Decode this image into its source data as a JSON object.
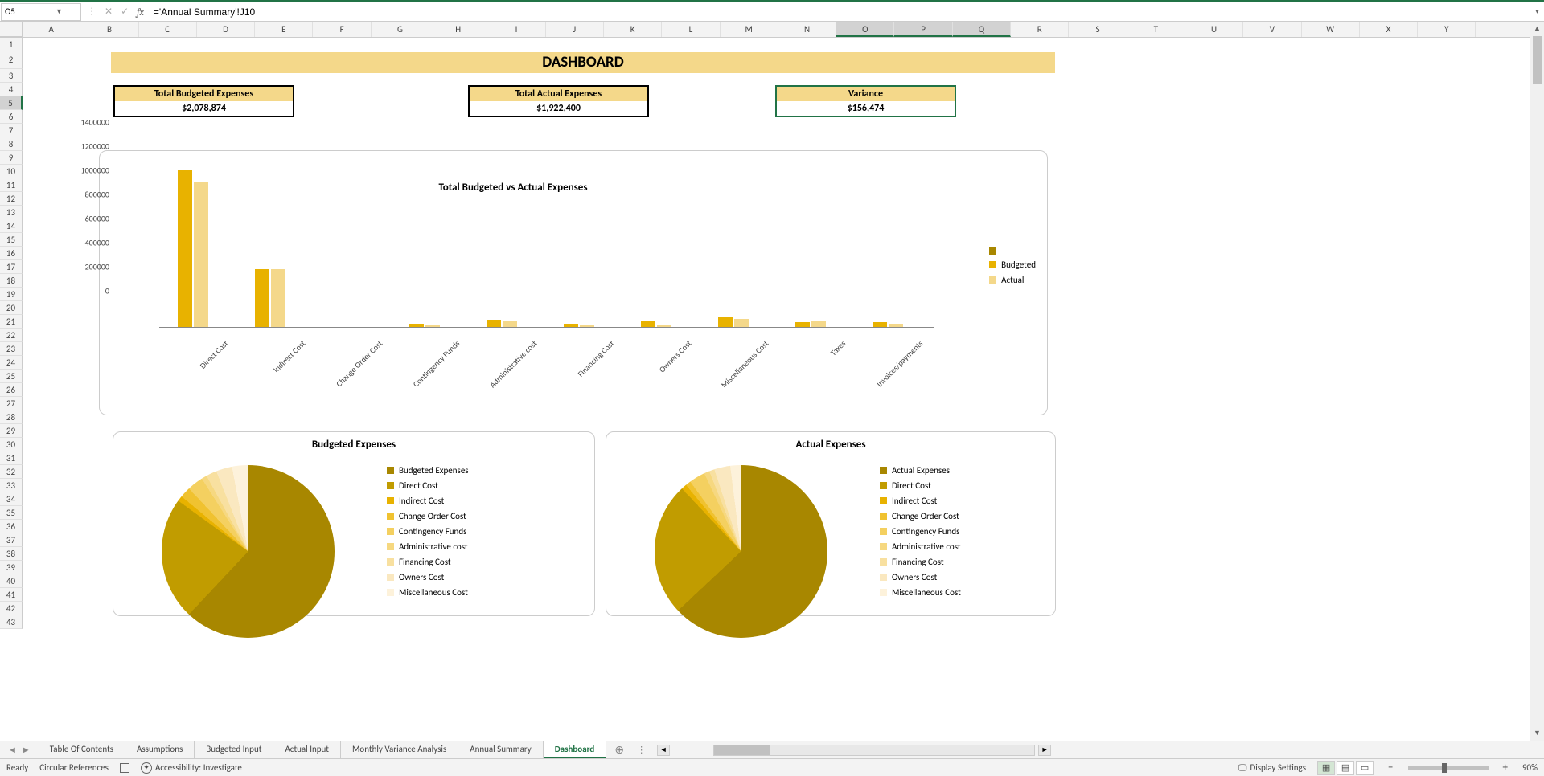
{
  "formula_bar": {
    "cell_ref": "O5",
    "formula": "='Annual Summary'!J10"
  },
  "columns": [
    "A",
    "B",
    "C",
    "D",
    "E",
    "F",
    "G",
    "H",
    "I",
    "J",
    "K",
    "L",
    "M",
    "N",
    "O",
    "P",
    "Q",
    "R",
    "S",
    "T",
    "U",
    "V",
    "W",
    "X",
    "Y"
  ],
  "selected_cols": [
    "O",
    "P",
    "Q"
  ],
  "rows": [
    1,
    2,
    3,
    4,
    5,
    6,
    7,
    8,
    9,
    10,
    11,
    12,
    13,
    14,
    15,
    16,
    17,
    18,
    19,
    20,
    21,
    22,
    23,
    24,
    25,
    26,
    27,
    28,
    29,
    30,
    31,
    32,
    33,
    34,
    35,
    36,
    37,
    38,
    39,
    40,
    41,
    42,
    43
  ],
  "selected_row": 5,
  "dashboard": {
    "title": "DASHBOARD",
    "kpis": [
      {
        "label": "Total Budgeted Expenses",
        "value": "$2,078,874"
      },
      {
        "label": "Total Actual Expenses",
        "value": "$1,922,400"
      },
      {
        "label": "Variance",
        "value": "$156,474",
        "selected": true
      }
    ]
  },
  "chart_data": [
    {
      "type": "bar",
      "title": "Total Budgeted vs Actual Expenses",
      "categories": [
        "Direct Cost",
        "Indirect Cost",
        "Change Order Cost",
        "Contingency Funds",
        "Administrative cost",
        "Financing Cost",
        "Owners Cost",
        "Miscellaneous Cost",
        "Taxes",
        "Invoices/payments"
      ],
      "series": [
        {
          "name": "Budgeted",
          "values": [
            1300000,
            480000,
            0,
            30000,
            60000,
            25000,
            50000,
            80000,
            40000,
            40000
          ]
        },
        {
          "name": "Actual",
          "values": [
            1210000,
            480000,
            0,
            15000,
            55000,
            20000,
            15000,
            70000,
            50000,
            30000
          ]
        }
      ],
      "ylim": [
        0,
        1400000
      ],
      "y_ticks": [
        0,
        200000,
        400000,
        600000,
        800000,
        1000000,
        1200000,
        1400000
      ],
      "xlabel": "",
      "ylabel": "",
      "legend_extra_marker": true
    },
    {
      "type": "pie",
      "title": "Budgeted Expenses",
      "legend": [
        "Budgeted Expenses",
        "Direct Cost",
        "Indirect Cost",
        "Change Order Cost",
        "Contingency Funds",
        "Administrative cost",
        "Financing Cost",
        "Owners Cost",
        "Miscellaneous Cost"
      ],
      "colors": [
        "#a88700",
        "#c19c00",
        "#e8b200",
        "#f0c230",
        "#f4d060",
        "#f6d880",
        "#f8e0a0",
        "#fae8c0",
        "#fdf2db"
      ],
      "values": [
        62,
        23,
        1,
        2,
        3,
        1,
        2,
        3,
        3
      ]
    },
    {
      "type": "pie",
      "title": "Actual Expenses",
      "legend": [
        "Actual Expenses",
        "Direct Cost",
        "Indirect Cost",
        "Change Order Cost",
        "Contingency Funds",
        "Administrative cost",
        "Financing Cost",
        "Owners Cost",
        "Miscellaneous Cost"
      ],
      "colors": [
        "#a88700",
        "#c19c00",
        "#e8b200",
        "#f0c230",
        "#f4d060",
        "#f6d880",
        "#f8e0a0",
        "#fae8c0",
        "#fdf2db"
      ],
      "values": [
        63,
        25,
        1,
        1,
        3,
        1,
        1,
        3,
        2
      ]
    }
  ],
  "sheet_tabs": [
    "Table Of Contents",
    "Assumptions",
    "Budgeted Input",
    "Actual Input",
    "Monthly Variance Analysis",
    "Annual Summary",
    "Dashboard"
  ],
  "active_tab": "Dashboard",
  "status_bar": {
    "ready": "Ready",
    "circular": "Circular References",
    "accessibility": "Accessibility: Investigate",
    "display_settings": "Display Settings",
    "zoom": "90%"
  }
}
